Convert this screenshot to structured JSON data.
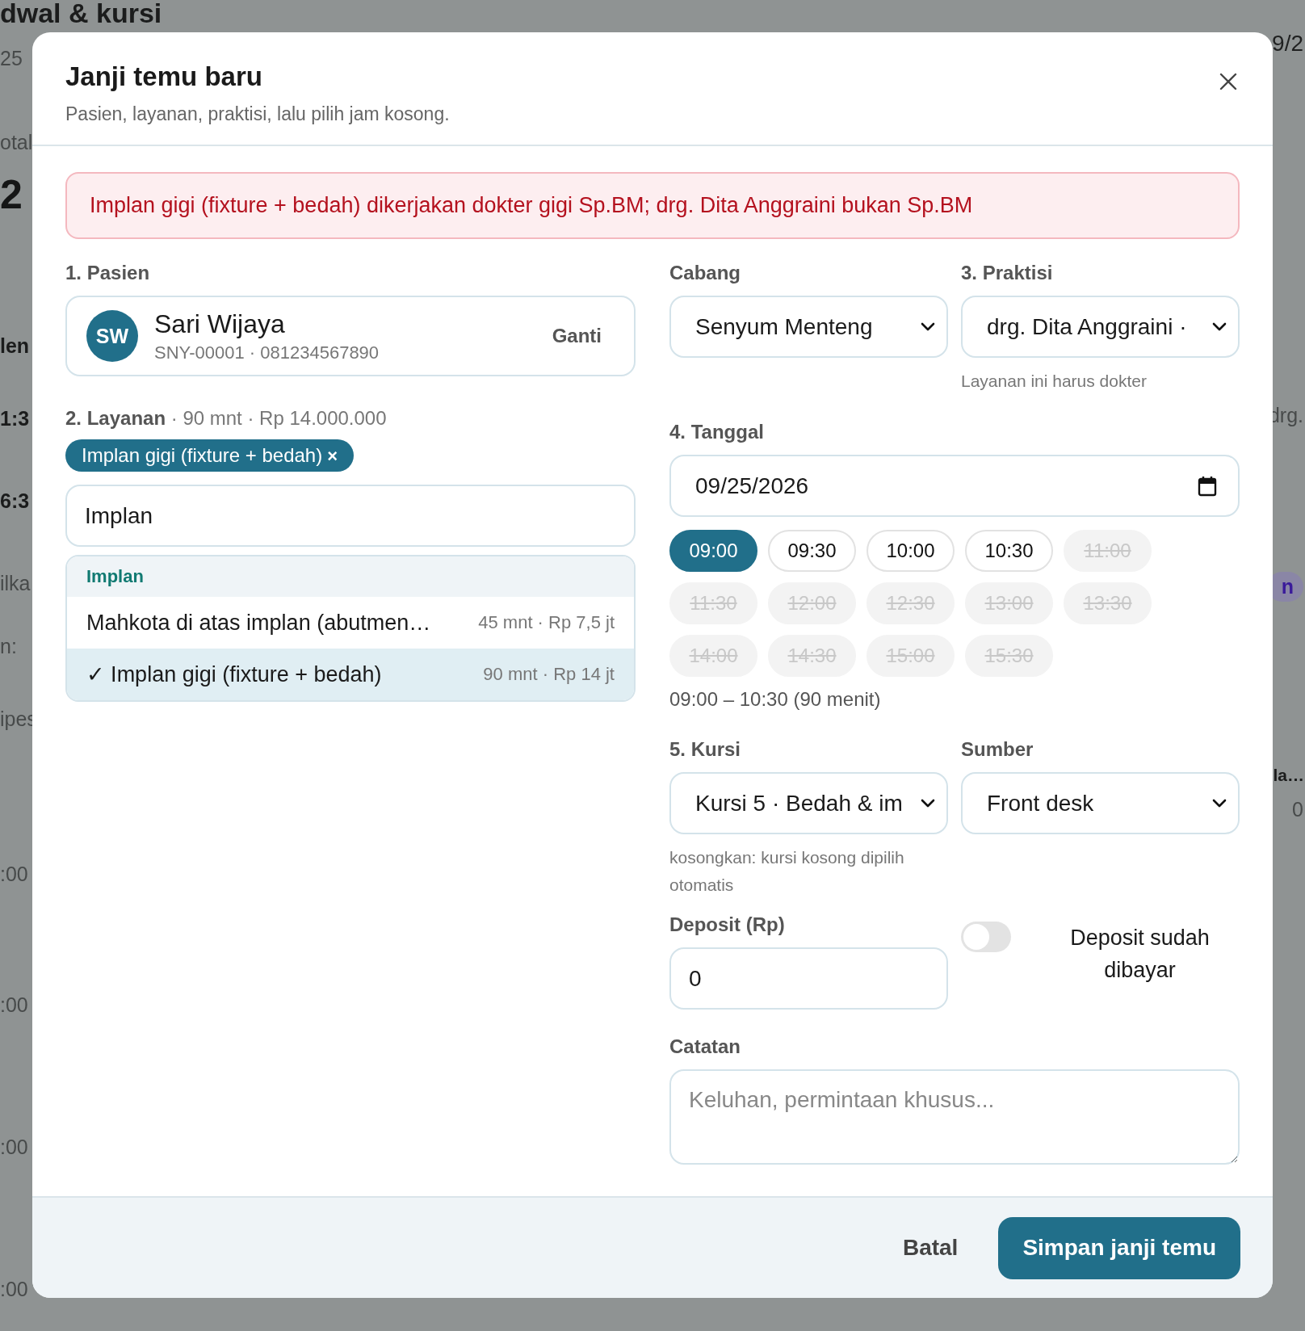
{
  "backdrop": {
    "left_edge": [
      {
        "text": "dwal & kursi",
        "kind": "heading"
      },
      {
        "text": "25",
        "kind": "muted"
      },
      {
        "text": "otal",
        "kind": "muted"
      },
      {
        "text": "2",
        "kind": "big"
      },
      {
        "text": "len",
        "kind": "strong"
      },
      {
        "text": "1:3",
        "kind": "strong"
      },
      {
        "text": "6:3",
        "kind": "strong"
      },
      {
        "text": "ilka",
        "kind": "muted"
      },
      {
        "text": "n:",
        "kind": "muted"
      },
      {
        "text": "ipes",
        "kind": "muted"
      },
      {
        "text": ":00",
        "kind": "muted"
      },
      {
        "text": ":00",
        "kind": "muted"
      },
      {
        "text": ":00",
        "kind": "muted"
      },
      {
        "text": ":00",
        "kind": "muted"
      }
    ],
    "right_edge": [
      {
        "text": "9/2",
        "kind": "plain"
      },
      {
        "text": "drg.",
        "kind": "muted"
      },
      {
        "text": "n",
        "kind": "tag"
      },
      {
        "text": "la…",
        "kind": "strong"
      },
      {
        "text": "0",
        "kind": "muted"
      }
    ]
  },
  "dialog": {
    "title": "Janji temu baru",
    "subtitle": "Pasien, layanan, praktisi, lalu pilih jam kosong.",
    "alert": "Implan gigi (fixture + bedah) dikerjakan dokter gigi Sp.BM; drg. Dita Anggraini bukan Sp.BM",
    "patient": {
      "label": "1. Pasien",
      "initials": "SW",
      "name": "Sari Wijaya",
      "meta": "SNY-00001 · 081234567890",
      "action": "Ganti"
    },
    "service": {
      "label": "2. Layanan",
      "summary": "· 90 mnt · Rp 14.000.000",
      "chips": [
        {
          "label": "Implan gigi (fixture + bedah)",
          "remove": "×"
        }
      ],
      "search": {
        "value": "Implan"
      },
      "results": {
        "group": "Implan",
        "items": [
          {
            "name": "Mahkota di atas implan (abutmen…",
            "meta": "45 mnt · Rp 7,5 jt",
            "selected": false
          },
          {
            "check": "✓",
            "name": "Implan gigi (fixture + bedah)",
            "meta": "90 mnt · Rp 14 jt",
            "selected": true
          }
        ]
      }
    },
    "branch": {
      "label": "Cabang",
      "value": "Senyum Menteng"
    },
    "practitioner": {
      "label": "3. Praktisi",
      "value": "drg. Dita Anggraini ·",
      "hint": "Layanan ini harus dokter"
    },
    "date": {
      "label": "4. Tanggal",
      "value": "09/25/2026"
    },
    "slots": [
      {
        "time": "09:00",
        "selected": true,
        "disabled": false
      },
      {
        "time": "09:30",
        "selected": false,
        "disabled": false
      },
      {
        "time": "10:00",
        "selected": false,
        "disabled": false
      },
      {
        "time": "10:30",
        "selected": false,
        "disabled": false
      },
      {
        "time": "11:00",
        "selected": false,
        "disabled": true
      },
      {
        "time": "11:30",
        "selected": false,
        "disabled": true
      },
      {
        "time": "12:00",
        "selected": false,
        "disabled": true
      },
      {
        "time": "12:30",
        "selected": false,
        "disabled": true
      },
      {
        "time": "13:00",
        "selected": false,
        "disabled": true
      },
      {
        "time": "13:30",
        "selected": false,
        "disabled": true
      },
      {
        "time": "14:00",
        "selected": false,
        "disabled": true
      },
      {
        "time": "14:30",
        "selected": false,
        "disabled": true
      },
      {
        "time": "15:00",
        "selected": false,
        "disabled": true
      },
      {
        "time": "15:30",
        "selected": false,
        "disabled": true
      }
    ],
    "range": "09:00 – 10:30 (90 menit)",
    "chair": {
      "label": "5. Kursi",
      "value": "Kursi 5 · Bedah & im",
      "hint": "kosongkan: kursi kosong dipilih otomatis"
    },
    "source": {
      "label": "Sumber",
      "value": "Front desk"
    },
    "deposit": {
      "label": "Deposit (Rp)",
      "value": "0",
      "paid": {
        "label": "Deposit sudah dibayar",
        "on": false
      }
    },
    "notes": {
      "label": "Catatan",
      "placeholder": "Keluhan, permintaan khusus..."
    },
    "footer": {
      "cancel": "Batal",
      "submit": "Simpan janji temu"
    }
  }
}
